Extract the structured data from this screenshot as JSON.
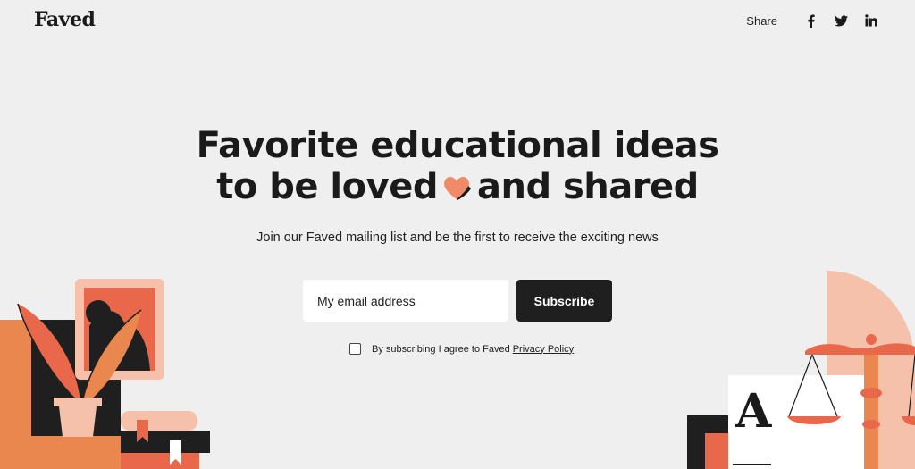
{
  "header": {
    "logo": "Faved",
    "share_label": "Share",
    "icons": [
      "facebook-icon",
      "twitter-icon",
      "linkedin-icon"
    ]
  },
  "hero": {
    "line1": "Favorite educational ideas",
    "line2_before": "to be loved",
    "line2_after": "and shared",
    "subtext": "Join our Faved mailing list and be the first to receive the exciting news"
  },
  "form": {
    "email_placeholder": "My email address",
    "subscribe_label": "Subscribe",
    "consent_text": "By subscribing I agree to Faved",
    "privacy_link": "Privacy Policy"
  },
  "colors": {
    "background": "#efefef",
    "accent": "#f08a68",
    "dark": "#1f1f1f",
    "coral": "#e9674a",
    "peach": "#f5c1aa"
  }
}
